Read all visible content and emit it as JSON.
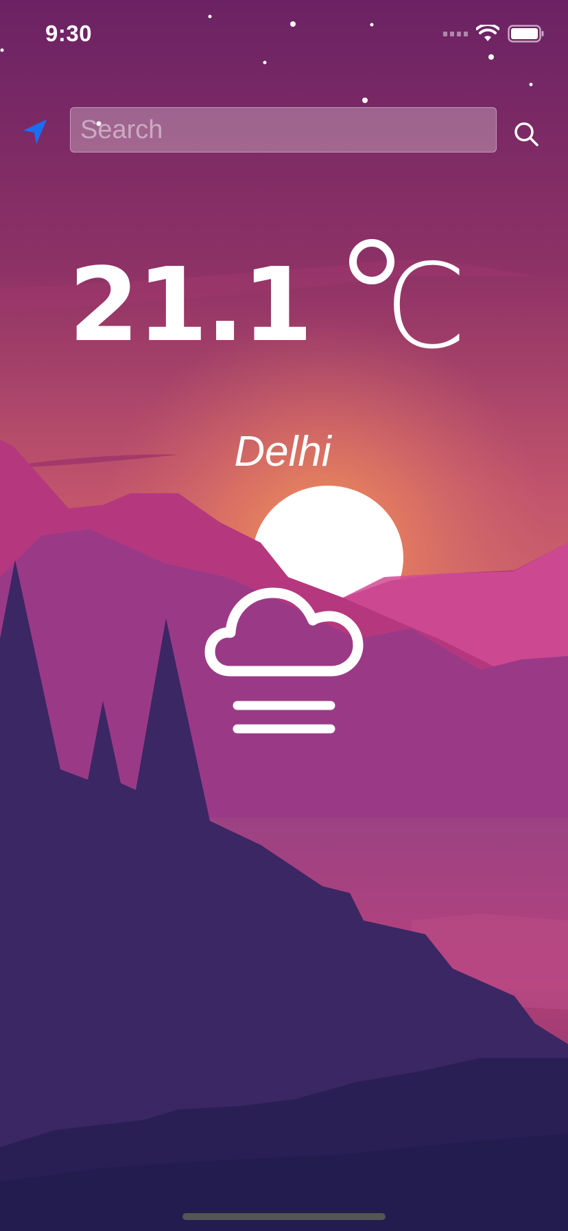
{
  "status_bar": {
    "time": "9:30"
  },
  "search": {
    "placeholder": "Search",
    "value": ""
  },
  "weather": {
    "temperature": "21.1",
    "unit_letter": "C",
    "city": "Delhi",
    "condition_icon": "fog-cloud-icon"
  },
  "icons": {
    "location": "location-arrow-icon",
    "search": "magnifier-icon"
  },
  "colors": {
    "location_accent": "#1a6ef5",
    "text": "#ffffff"
  }
}
